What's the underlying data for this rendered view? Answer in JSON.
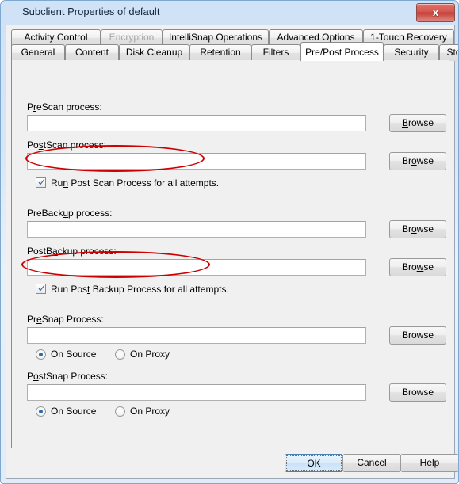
{
  "window": {
    "title": "Subclient Properties of default",
    "close_label": "x"
  },
  "tabs": {
    "top_row": [
      {
        "label": "Activity Control",
        "state": "enabled"
      },
      {
        "label": "Encryption",
        "state": "disabled"
      },
      {
        "label": "IntelliSnap Operations",
        "state": "enabled"
      },
      {
        "label": "Advanced Options",
        "state": "enabled"
      },
      {
        "label": "1-Touch Recovery",
        "state": "enabled"
      }
    ],
    "bottom_row": [
      {
        "label": "General",
        "state": "enabled"
      },
      {
        "label": "Content",
        "state": "enabled"
      },
      {
        "label": "Disk Cleanup",
        "state": "enabled"
      },
      {
        "label": "Retention",
        "state": "enabled"
      },
      {
        "label": "Filters",
        "state": "enabled"
      },
      {
        "label": "Pre/Post Process",
        "state": "selected"
      },
      {
        "label": "Security",
        "state": "enabled"
      },
      {
        "label": "Storage Device",
        "state": "enabled"
      }
    ]
  },
  "form": {
    "prescan": {
      "label_pre": "P",
      "label_accel": "r",
      "label_post": "eScan process:",
      "value": "",
      "browse_pre": "",
      "browse_accel": "B",
      "browse_post": "rowse"
    },
    "postscan": {
      "label_pre": "Po",
      "label_accel": "s",
      "label_post": "tScan process:",
      "value": "",
      "browse_pre": "Br",
      "browse_accel": "o",
      "browse_post": "wse"
    },
    "run_post_scan": {
      "checked": true,
      "text_pre": "Ru",
      "text_accel": "n",
      "text_post": " Post Scan Process for all attempts."
    },
    "prebackup": {
      "label_pre": "PreBack",
      "label_accel": "u",
      "label_post": "p process:",
      "value": "",
      "browse_pre": "Br",
      "browse_accel": "o",
      "browse_post": "wse"
    },
    "postbackup": {
      "label_pre": "PostB",
      "label_accel": "a",
      "label_post": "ckup process:",
      "value": "",
      "browse_pre": "Bro",
      "browse_accel": "w",
      "browse_post": "se"
    },
    "run_post_backup": {
      "checked": true,
      "text_pre": "Run Pos",
      "text_accel": "t",
      "text_post": " Backup Process for all attempts."
    },
    "presnap": {
      "label_pre": "Pr",
      "label_accel": "e",
      "label_post": "Snap Process:",
      "value": "",
      "browse_pre": "Browse",
      "browse_accel": "",
      "browse_post": "",
      "radios": [
        {
          "label": "On Source",
          "selected": true
        },
        {
          "label": "On Proxy",
          "selected": false
        }
      ]
    },
    "postsnap": {
      "label_pre": "P",
      "label_accel": "o",
      "label_post": "stSnap Process:",
      "value": "",
      "browse_pre": "Browse",
      "browse_accel": "",
      "browse_post": "",
      "radios": [
        {
          "label": "On Source",
          "selected": true
        },
        {
          "label": "On Proxy",
          "selected": false
        }
      ]
    }
  },
  "buttons": {
    "ok": "OK",
    "cancel": "Cancel",
    "help": "Help"
  },
  "annotations": {
    "color": "#cc0000",
    "count": 2
  }
}
